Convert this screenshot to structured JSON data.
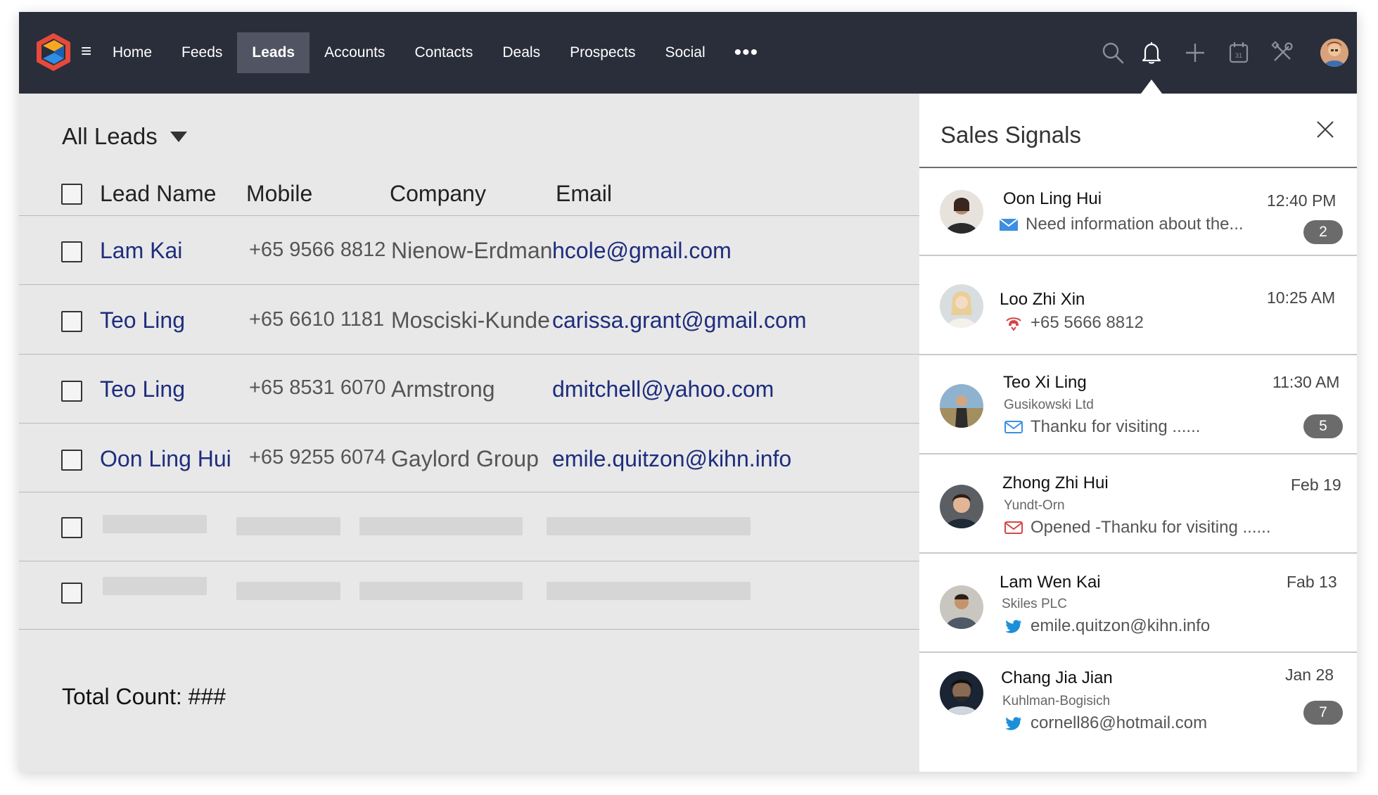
{
  "nav": {
    "items": [
      {
        "label": "Home",
        "active": false
      },
      {
        "label": "Feeds",
        "active": false
      },
      {
        "label": "Leads",
        "active": true
      },
      {
        "label": "Accounts",
        "active": false
      },
      {
        "label": "Contacts",
        "active": false
      },
      {
        "label": "Deals",
        "active": false
      },
      {
        "label": "Prospects",
        "active": false
      },
      {
        "label": "Social",
        "active": false
      }
    ],
    "more_label": "•••",
    "menu_glyph": "≡",
    "icons": [
      "search-icon",
      "bell-icon",
      "plus-icon",
      "calendar-icon",
      "tools-icon"
    ],
    "calendar_day": "31"
  },
  "leads": {
    "view_label": "All Leads",
    "columns": {
      "name": "Lead Name",
      "mobile": "Mobile",
      "company": "Company",
      "email": "Email"
    },
    "rows": [
      {
        "name": "Lam Kai",
        "mobile": "+65 9566 8812",
        "company": "Nienow-Erdman",
        "email": "hcole@gmail.com"
      },
      {
        "name": "Teo Ling",
        "mobile": "+65 6610 1181",
        "company": "Mosciski-Kunde",
        "email": "carissa.grant@gmail.com"
      },
      {
        "name": "Teo Ling",
        "mobile": "+65 8531 6070",
        "company": "Armstrong",
        "email": "dmitchell@yahoo.com"
      },
      {
        "name": "Oon Ling Hui",
        "mobile": "+65 9255 6074",
        "company": "Gaylord Group",
        "email": "emile.quitzon@kihn.info"
      }
    ],
    "placeholder_rows": 2,
    "total_label": "Total Count: ###"
  },
  "signals": {
    "title": "Sales Signals",
    "items": [
      {
        "name": "Oon Ling Hui",
        "time": "12:40 PM",
        "company": "",
        "detail": "Need information about the...",
        "icon": "mail-filled-icon",
        "badge": "2"
      },
      {
        "name": "Loo Zhi Xin",
        "time": "10:25 AM",
        "company": "",
        "detail": "+65 5666 8812",
        "icon": "phone-call-icon",
        "badge": ""
      },
      {
        "name": "Teo Xi Ling",
        "time": "11:30 AM",
        "company": "Gusikowski Ltd",
        "detail": "Thanku for visiting ......",
        "icon": "mail-outline-icon",
        "badge": "5"
      },
      {
        "name": "Zhong Zhi Hui",
        "time": "Feb 19",
        "company": "Yundt-Orn",
        "detail": "Opened -Thanku for visiting ......",
        "icon": "mail-opened-icon",
        "badge": ""
      },
      {
        "name": "Lam Wen Kai",
        "time": "Fab 13",
        "company": "Skiles PLC",
        "detail": "emile.quitzon@kihn.info",
        "icon": "twitter-icon",
        "badge": ""
      },
      {
        "name": "Chang Jia Jian",
        "time": "Jan 28",
        "company": "Kuhlman-Bogisich",
        "detail": "cornell86@hotmail.com",
        "icon": "twitter-icon",
        "badge": "7"
      }
    ]
  },
  "colors": {
    "nav_bg": "#2a2d3a",
    "nav_active": "#515463",
    "link": "#1e2d7d",
    "badge": "#6b6b6b",
    "mail_blue": "#3d8fe0",
    "mail_red": "#d64545",
    "twitter": "#1d8fd8"
  }
}
